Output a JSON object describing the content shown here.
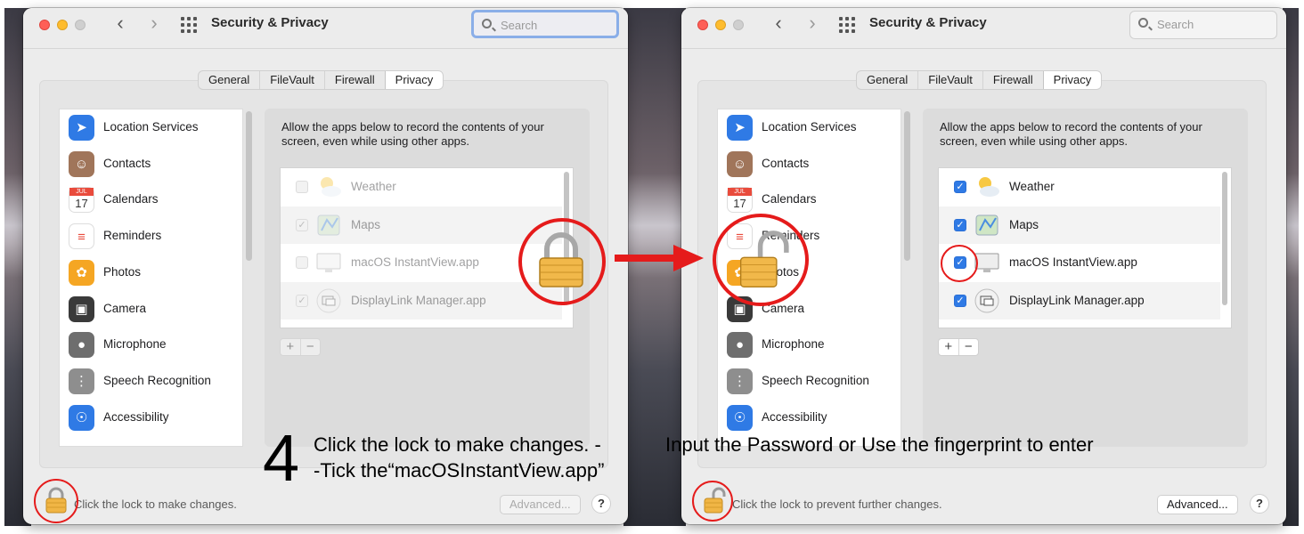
{
  "left": {
    "window_title": "Security & Privacy",
    "search_placeholder": "Search",
    "tabs": [
      "General",
      "FileVault",
      "Firewall",
      "Privacy"
    ],
    "active_tab": "Privacy",
    "sidebar": [
      {
        "label": "Location Services",
        "icon": "location-arrow-icon",
        "color": "#2f7ae5"
      },
      {
        "label": "Contacts",
        "icon": "contacts-book-icon",
        "color": "#a0755a"
      },
      {
        "label": "Calendars",
        "icon": "calendar-icon",
        "color": "#e94b3c"
      },
      {
        "label": "Reminders",
        "icon": "reminders-list-icon",
        "color": "#ffffff"
      },
      {
        "label": "Photos",
        "icon": "photos-flower-icon",
        "color": "#f5a623"
      },
      {
        "label": "Camera",
        "icon": "camera-icon",
        "color": "#3a3a3a"
      },
      {
        "label": "Microphone",
        "icon": "microphone-icon",
        "color": "#6e6e6e"
      },
      {
        "label": "Speech Recognition",
        "icon": "waveform-icon",
        "color": "#8e8e8e"
      },
      {
        "label": "Accessibility",
        "icon": "accessibility-person-icon",
        "color": "#2f7ae5"
      }
    ],
    "calendar_month": "JUL",
    "calendar_day": "17",
    "description": "Allow the apps below to record the contents of your screen, even while using other apps.",
    "apps": [
      {
        "label": "Weather",
        "checked": false,
        "icon": "weather-sun-cloud-icon"
      },
      {
        "label": "Maps",
        "checked": true,
        "icon": "maps-icon"
      },
      {
        "label": "macOS InstantView.app",
        "checked": false,
        "icon": "display-monitor-icon"
      },
      {
        "label": "DisplayLink Manager.app",
        "checked": true,
        "icon": "displaylink-icon"
      }
    ],
    "add_label": "+",
    "remove_label": "−",
    "lock_text": "Click the lock to make changes.",
    "advanced_label": "Advanced...",
    "help_label": "?"
  },
  "right": {
    "window_title": "Security & Privacy",
    "search_placeholder": "Search",
    "tabs": [
      "General",
      "FileVault",
      "Firewall",
      "Privacy"
    ],
    "active_tab": "Privacy",
    "sidebar": [
      {
        "label": "Location Services",
        "icon": "location-arrow-icon",
        "color": "#2f7ae5"
      },
      {
        "label": "Contacts",
        "icon": "contacts-book-icon",
        "color": "#a0755a"
      },
      {
        "label": "Calendars",
        "icon": "calendar-icon",
        "color": "#e94b3c"
      },
      {
        "label": "Reminders",
        "icon": "reminders-list-icon",
        "color": "#ffffff"
      },
      {
        "label": "Photos",
        "icon": "photos-flower-icon",
        "color": "#f5a623"
      },
      {
        "label": "Camera",
        "icon": "camera-icon",
        "color": "#3a3a3a"
      },
      {
        "label": "Microphone",
        "icon": "microphone-icon",
        "color": "#6e6e6e"
      },
      {
        "label": "Speech Recognition",
        "icon": "waveform-icon",
        "color": "#8e8e8e"
      },
      {
        "label": "Accessibility",
        "icon": "accessibility-person-icon",
        "color": "#2f7ae5"
      }
    ],
    "calendar_month": "JUL",
    "calendar_day": "17",
    "description": "Allow the apps below to record the contents of your screen, even while using other apps.",
    "apps": [
      {
        "label": "Weather",
        "checked": true,
        "icon": "weather-sun-cloud-icon"
      },
      {
        "label": "Maps",
        "checked": true,
        "icon": "maps-icon"
      },
      {
        "label": "macOS InstantView.app",
        "checked": true,
        "icon": "display-monitor-icon"
      },
      {
        "label": "DisplayLink Manager.app",
        "checked": true,
        "icon": "displaylink-icon"
      }
    ],
    "add_label": "+",
    "remove_label": "−",
    "lock_text": "Click the lock to prevent further changes.",
    "advanced_label": "Advanced...",
    "help_label": "?"
  },
  "annotations": {
    "step_number": "4",
    "line1": "Click the lock to make changes.  -",
    "line2": "-Tick the“macOSInstantView.app”",
    "line3": "Input the Password or Use the fingerprint to enter",
    "accent_color": "#e51b1b"
  }
}
